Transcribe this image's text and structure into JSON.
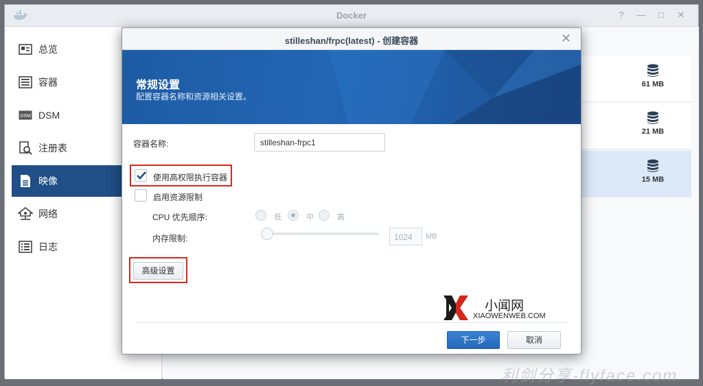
{
  "app": {
    "title": "Docker"
  },
  "window_controls": [
    "?",
    "—",
    "□",
    "✕"
  ],
  "sidebar": {
    "items": [
      {
        "label": "总览",
        "icon": "overview-icon",
        "active": false
      },
      {
        "label": "容器",
        "icon": "container-icon",
        "active": false
      },
      {
        "label": "DSM",
        "icon": "dsm-icon",
        "active": false
      },
      {
        "label": "注册表",
        "icon": "registry-icon",
        "active": false
      },
      {
        "label": "映像",
        "icon": "image-icon",
        "active": true
      },
      {
        "label": "网络",
        "icon": "network-icon",
        "active": false
      },
      {
        "label": "日志",
        "icon": "log-icon",
        "active": false
      }
    ]
  },
  "image_list": {
    "rows": [
      {
        "size": "61 MB",
        "selected": false
      },
      {
        "size": "21 MB",
        "selected": false
      },
      {
        "size": "15 MB",
        "selected": true
      }
    ]
  },
  "dialog": {
    "title": "stilleshan/frpc(latest) - 创建容器",
    "close": "✕",
    "banner_title": "常规设置",
    "banner_subtitle": "配置容器名称和资源相关设置。",
    "name_label": "容器名称:",
    "name_value": "stilleshan-frpc1",
    "privileged_label": "使用高权限执行容器",
    "privileged_checked": true,
    "resource_limit_label": "启用资源限制",
    "resource_limit_checked": false,
    "cpu_label": "CPU 优先顺序:",
    "cpu_options": [
      "低",
      "中",
      "高"
    ],
    "cpu_selected": "中",
    "memory_label": "内存限制:",
    "memory_value": "1024",
    "memory_unit": "MB",
    "advanced_button": "高级设置",
    "next_button": "下一步",
    "cancel_button": "取消"
  },
  "watermarks": {
    "site_cn": "小闻网",
    "site_en": "XIAOWENWEB.COM",
    "bottom_text": "利剑分享-flyface.com"
  },
  "colors": {
    "accent": "#1f4f86",
    "banner": "#2468b8",
    "highlight": "#d9261c",
    "primary_button": "#2c73c6"
  }
}
